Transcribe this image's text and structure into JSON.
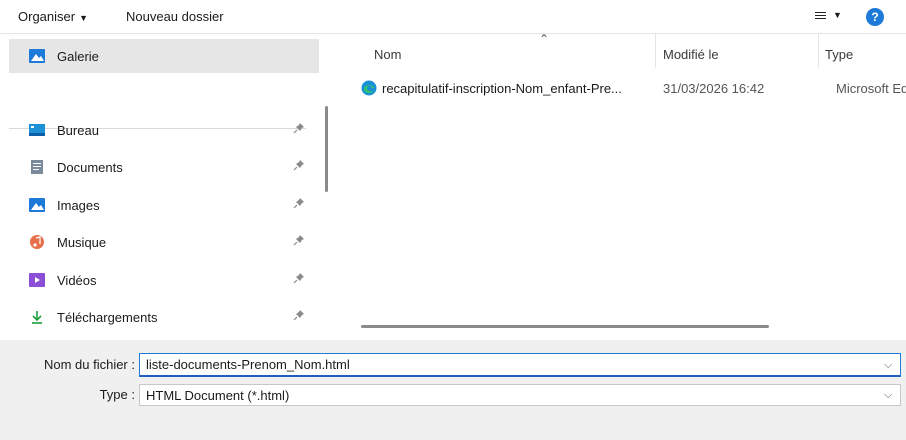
{
  "toolbar": {
    "organise_label": "Organiser",
    "new_folder_label": "Nouveau dossier",
    "view_icon": "list-view-icon",
    "help_icon": "help-icon",
    "help_label": "?"
  },
  "sidebar": {
    "items": [
      {
        "label": "Galerie",
        "icon": "gallery-icon",
        "selected": true
      },
      {
        "label": "Bureau",
        "icon": "desktop-icon",
        "pinned": true
      },
      {
        "label": "Documents",
        "icon": "documents-icon",
        "pinned": true
      },
      {
        "label": "Images",
        "icon": "images-icon",
        "pinned": true
      },
      {
        "label": "Musique",
        "icon": "music-icon",
        "pinned": true
      },
      {
        "label": "Vidéos",
        "icon": "videos-icon",
        "pinned": true
      },
      {
        "label": "Téléchargements",
        "icon": "downloads-icon",
        "pinned": true
      }
    ]
  },
  "filelist": {
    "columns": [
      "Nom",
      "Modifié le",
      "Type"
    ],
    "files": [
      {
        "name": "recapitulatif-inscription-Nom_enfant-Pre...",
        "modified": "31/03/2026 16:42",
        "type": "Microsoft Ed",
        "icon": "edge-icon"
      }
    ]
  },
  "bottom": {
    "filename_label": "Nom du fichier :",
    "filename_value": "liste-documents-Prenom_Nom.html",
    "type_label": "Type :",
    "type_value": "HTML Document (*.html)"
  },
  "colors": {
    "accent": "#1e7ad9",
    "selected_bg": "#e6e6e6",
    "footer_bg": "#f0f0f0"
  }
}
